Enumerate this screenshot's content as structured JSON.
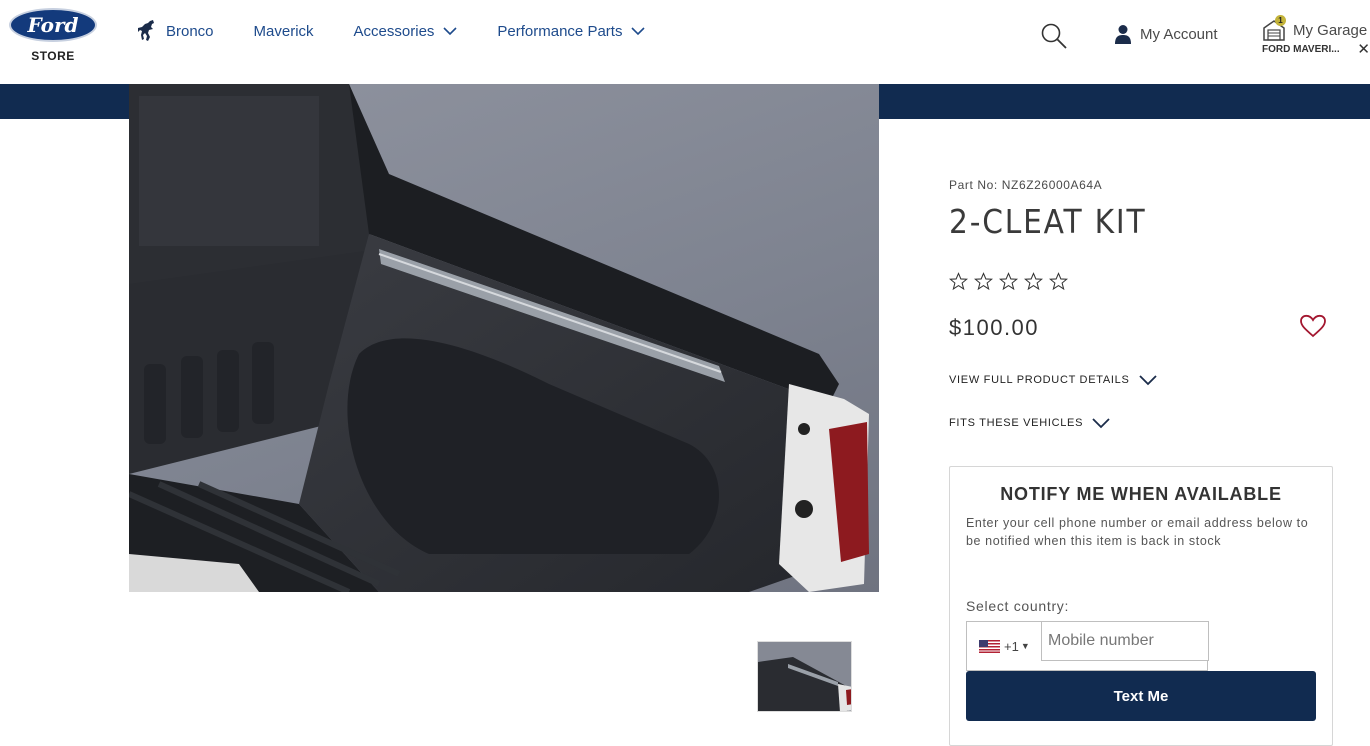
{
  "header": {
    "logo_text": "Ford",
    "store_label": "STORE",
    "nav": [
      {
        "label": "Bronco"
      },
      {
        "label": "Maverick"
      },
      {
        "label": "Accessories"
      },
      {
        "label": "Performance Parts"
      }
    ],
    "account_label": "My Account",
    "garage_label": "My Garage",
    "garage_count": "1",
    "garage_vehicle": "FORD MAVERI...",
    "garage_close": "✕"
  },
  "product": {
    "part_no": "Part No: NZ6Z26000A64A",
    "title": "2-CLEAT KIT",
    "rating": 0,
    "rating_max": 5,
    "price": "$100.00",
    "full_details_label": "VIEW FULL PRODUCT DETAILS",
    "fits_label": "FITS THESE VEHICLES"
  },
  "notify": {
    "title": "NOTIFY ME WHEN AVAILABLE",
    "description": "Enter your cell phone number or email address below to be notified when this item is back in stock",
    "country_label": "Select country:",
    "country_code": "+1",
    "phone_placeholder": "Mobile number",
    "button_label": "Text Me"
  },
  "colors": {
    "brand_navy": "#112b50",
    "nav_link": "#1e4b8c",
    "heart": "#a3162f"
  },
  "icons": {
    "search": "search-icon",
    "account": "user-icon",
    "garage": "garage-icon",
    "wishlist": "heart-icon",
    "expand": "chevron-down-icon"
  }
}
